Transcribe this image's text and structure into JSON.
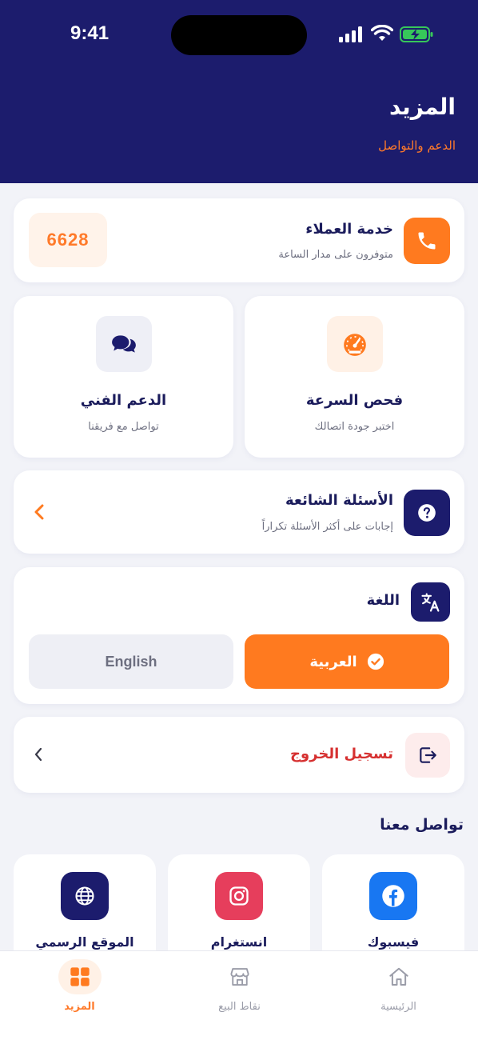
{
  "status_bar": {
    "time": "9:41",
    "signal_icon": "signal-icon",
    "wifi_icon": "wifi-icon",
    "battery_icon": "battery-charging-icon"
  },
  "header": {
    "title": "المزيد",
    "subtitle": "الدعم والتواصل"
  },
  "customer_service": {
    "title": "خدمة العملاء",
    "subtitle": "متوفرون على مدار الساعة",
    "code": "6628",
    "icon": "phone-icon"
  },
  "speed_test": {
    "title": "فحص السرعة",
    "subtitle": "اختبر جودة اتصالك",
    "icon": "speedometer-icon"
  },
  "tech_support": {
    "title": "الدعم الفني",
    "subtitle": "تواصل مع فريقنا",
    "icon": "chat-bubbles-icon"
  },
  "faq": {
    "title": "الأسئلة الشائعة",
    "subtitle": "إجابات على أكثر الأسئلة تكراراً",
    "icon": "question-icon"
  },
  "language": {
    "title": "اللغة",
    "arabic_label": "العربية",
    "english_label": "English",
    "selected": "arabic",
    "icon": "translate-icon"
  },
  "logout": {
    "label": "تسجيل الخروج",
    "icon": "logout-icon"
  },
  "contact": {
    "title": "تواصل معنا",
    "items": [
      {
        "label": "فيسبوك",
        "icon": "facebook-icon",
        "color": "#1877f2"
      },
      {
        "label": "انستغرام",
        "icon": "instagram-icon",
        "color": "#e63e5c"
      },
      {
        "label": "الموقع الرسمي",
        "icon": "globe-icon",
        "color": "#1c1c6d"
      }
    ]
  },
  "tabbar": {
    "home": "الرئيسية",
    "stores": "نقاط البيع",
    "more": "المزيد",
    "active": "more"
  },
  "colors": {
    "primary": "#1c1c6d",
    "accent": "#ff7a2a",
    "danger": "#d63030"
  }
}
